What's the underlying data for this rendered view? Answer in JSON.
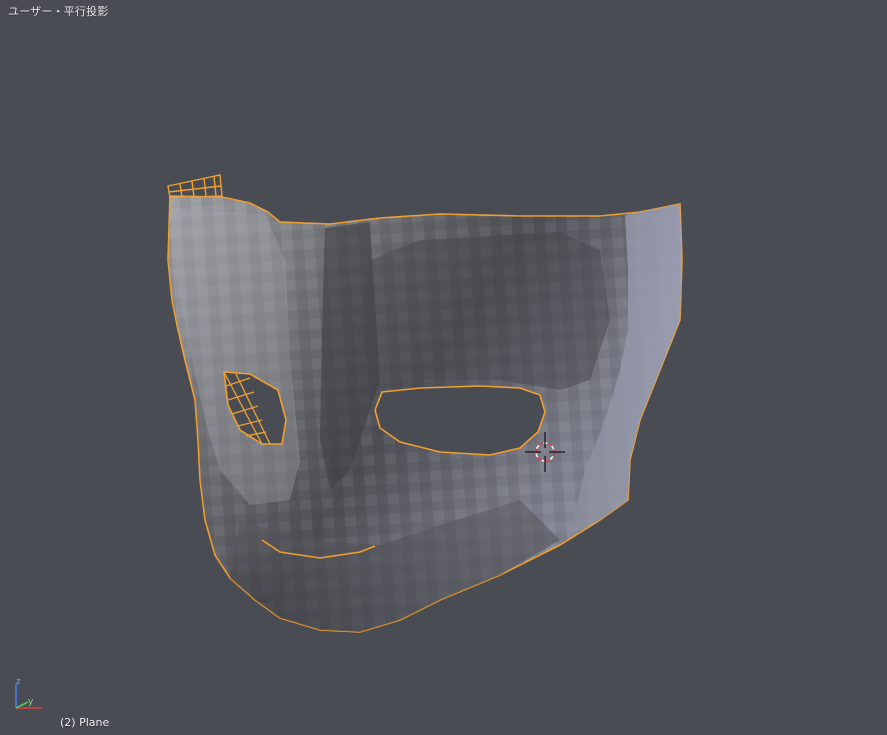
{
  "viewport": {
    "view_label": "ユーザー・平行投影",
    "object_label": "(2) Plane"
  },
  "gizmo": {
    "z_label": "z",
    "y_label": "y",
    "x_color": "#d84040",
    "y_color": "#58c858",
    "z_color": "#4a80e0"
  },
  "colors": {
    "background": "#4a4c54",
    "selection_outline": "#f0a030",
    "mesh_light": "#9a9ca4",
    "mesh_dark": "#3c3d42"
  },
  "icons": {
    "cursor": "3d-cursor-icon"
  }
}
